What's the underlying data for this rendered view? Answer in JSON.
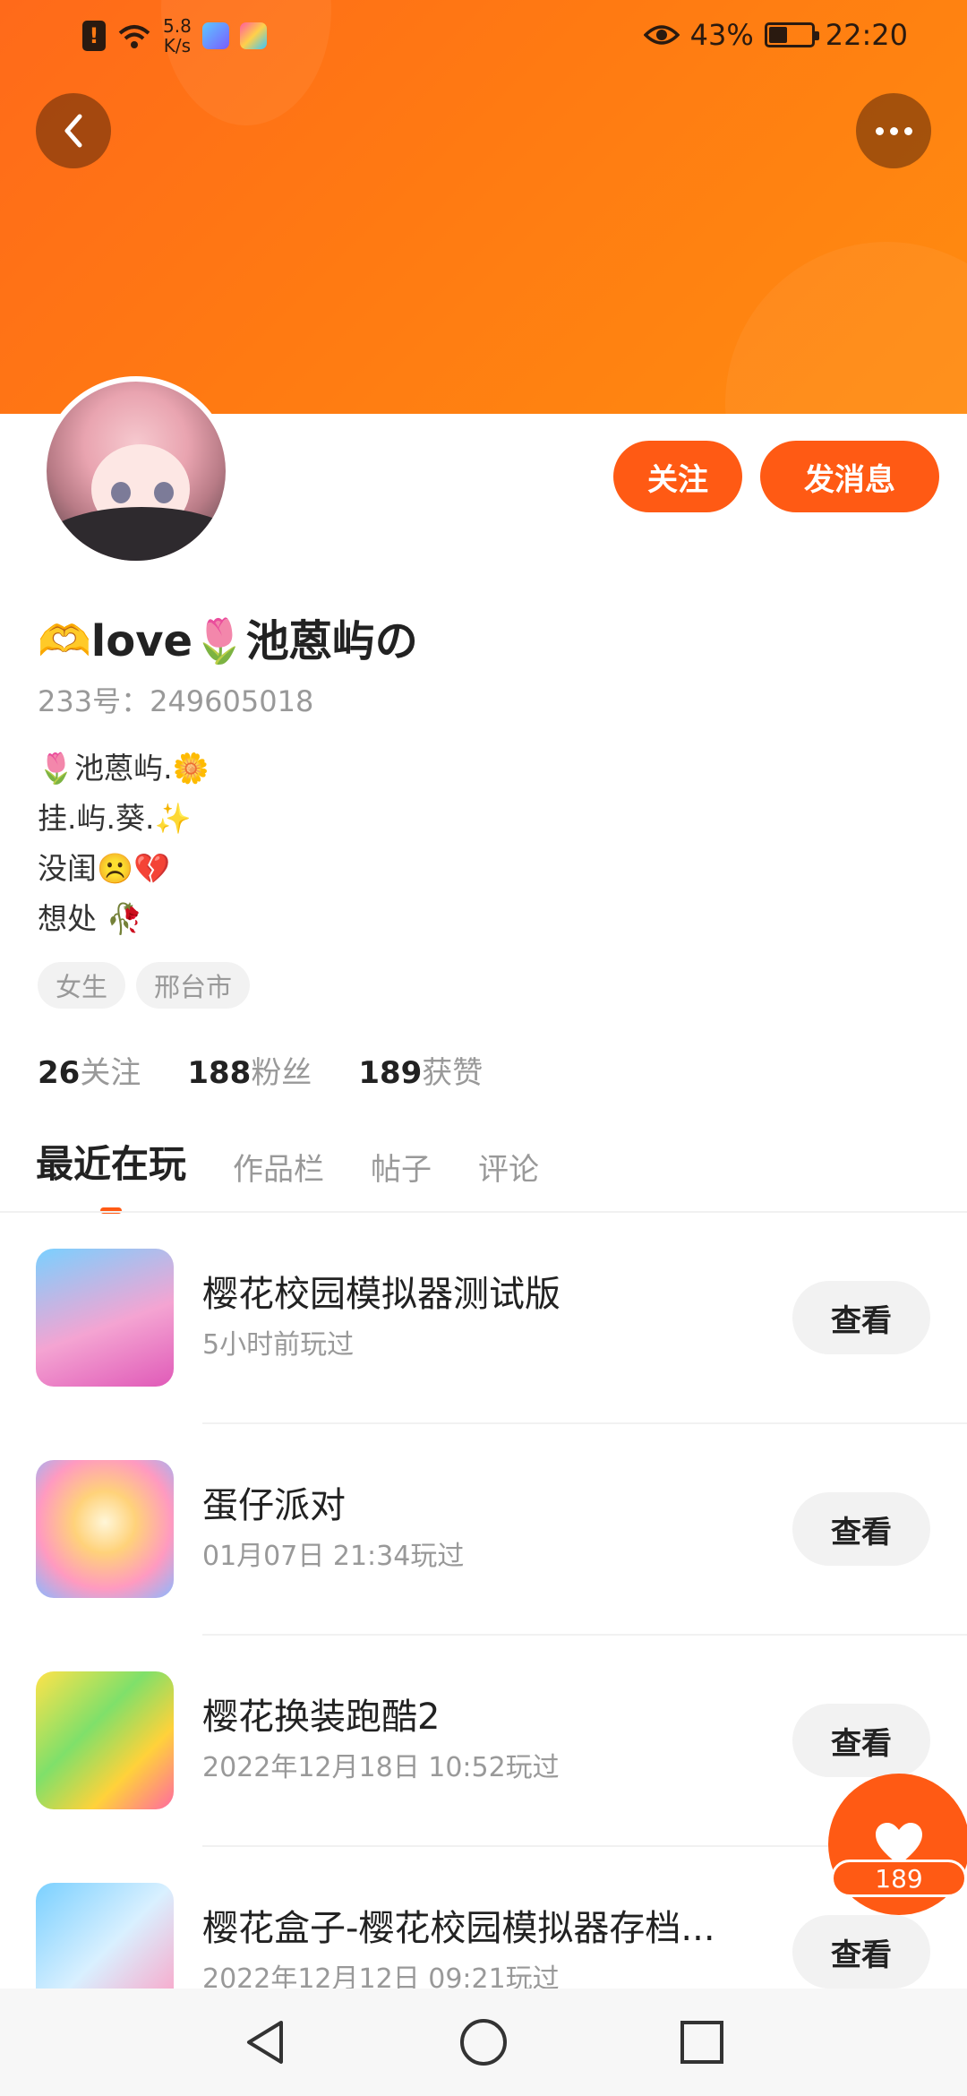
{
  "status_bar": {
    "speed": "5.8\nK/s",
    "battery_percent": "43%",
    "battery_level": 0.43,
    "time": "22:20"
  },
  "profile": {
    "name": "🫶love🌷池蒽屿の",
    "uid": "233号：249605018",
    "bio_lines": [
      "🌷池蒽屿.🌼",
      "挂.屿.葵.✨",
      "没闺☹️💔",
      "想处 🥀"
    ],
    "tags": [
      "女生",
      "邢台市"
    ]
  },
  "actions": {
    "follow": "关注",
    "message": "发消息"
  },
  "stats": {
    "following_count": "26",
    "following_label": "关注",
    "fans_count": "188",
    "fans_label": "粉丝",
    "likes_count": "189",
    "likes_label": "获赞"
  },
  "tabs": [
    "最近在玩",
    "作品栏",
    "帖子",
    "评论"
  ],
  "games": [
    {
      "title": "樱花校园模拟器测试版",
      "time": "5小时前玩过",
      "button": "查看"
    },
    {
      "title": "蛋仔派对",
      "time": "01月07日 21:34玩过",
      "button": "查看"
    },
    {
      "title": "樱花换装跑酷2",
      "time": "2022年12月18日 10:52玩过",
      "button": "查看"
    },
    {
      "title": "樱花盒子-樱花校园模拟器存档...",
      "time": "2022年12月12日 09:21玩过",
      "button": "查看"
    }
  ],
  "like_fab": {
    "count": "189"
  },
  "colors": {
    "accent": "#ff5a14",
    "banner": "#ff7a12"
  },
  "icons": [
    "back-arrow-icon",
    "more-dots-icon",
    "heart-icon",
    "nav-back-icon",
    "nav-home-icon",
    "nav-recents-icon",
    "eye-icon",
    "wifi-icon",
    "alert-icon",
    "battery-icon"
  ]
}
